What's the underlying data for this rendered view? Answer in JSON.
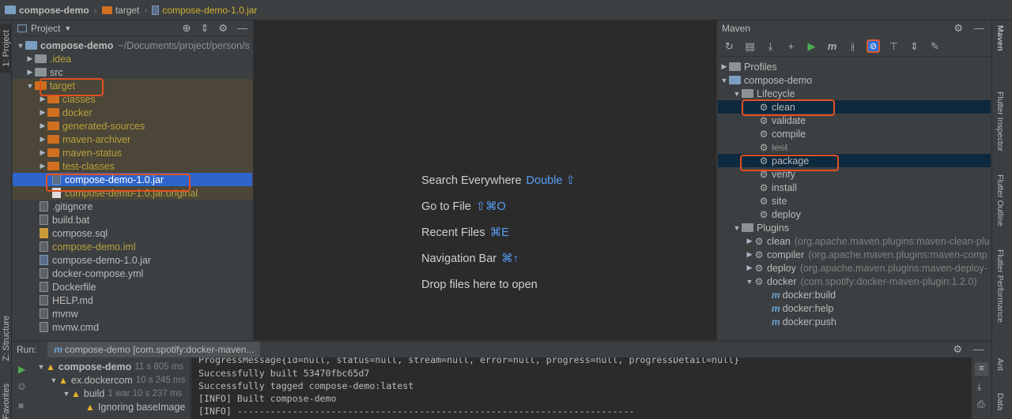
{
  "breadcrumb": {
    "project": "compose-demo",
    "folder": "target",
    "file": "compose-demo-1.0.jar"
  },
  "left_strip": {
    "project_tab": "1: Project",
    "structure_tab": "Z: Structure",
    "favorites_tab": "Favorites"
  },
  "project_panel": {
    "title": "Project",
    "root": {
      "name": "compose-demo",
      "path": "~/Documents/project/person/s"
    },
    "items": [
      {
        "label": ".idea"
      },
      {
        "label": "src"
      },
      {
        "label": "target"
      },
      {
        "label": "classes"
      },
      {
        "label": "docker"
      },
      {
        "label": "generated-sources"
      },
      {
        "label": "maven-archiver"
      },
      {
        "label": "maven-status"
      },
      {
        "label": "test-classes"
      },
      {
        "label": "compose-demo-1.0.jar"
      },
      {
        "label": "compose-demo-1.0.jar.original"
      },
      {
        "label": ".gitignore"
      },
      {
        "label": "build.bat"
      },
      {
        "label": "compose.sql"
      },
      {
        "label": "compose-demo.iml"
      },
      {
        "label": "compose-demo-1.0.jar"
      },
      {
        "label": "docker-compose.yml"
      },
      {
        "label": "Dockerfile"
      },
      {
        "label": "HELP.md"
      },
      {
        "label": "mvnw"
      },
      {
        "label": "mvnw.cmd"
      }
    ]
  },
  "editor_hints": [
    {
      "text": "Search Everywhere",
      "key": "Double ⇧"
    },
    {
      "text": "Go to File",
      "key": "⇧⌘O"
    },
    {
      "text": "Recent Files",
      "key": "⌘E"
    },
    {
      "text": "Navigation Bar",
      "key": "⌘↑"
    },
    {
      "text": "Drop files here to open",
      "key": ""
    }
  ],
  "maven": {
    "title": "Maven",
    "tree": {
      "profiles": "Profiles",
      "project": "compose-demo",
      "lifecycle": "Lifecycle",
      "phases": [
        "clean",
        "validate",
        "compile",
        "test",
        "package",
        "verify",
        "install",
        "site",
        "deploy"
      ],
      "plugins": "Plugins",
      "plugin_list": [
        {
          "name": "clean",
          "detail": "(org.apache.maven.plugins:maven-clean-plu"
        },
        {
          "name": "compiler",
          "detail": "(org.apache.maven.plugins:maven-comp"
        },
        {
          "name": "deploy",
          "detail": "(org.apache.maven.plugins:maven-deploy-"
        },
        {
          "name": "docker",
          "detail": "(com.spotify:docker-maven-plugin:1.2.0)"
        }
      ],
      "goals": [
        "docker:build",
        "docker:help",
        "docker:push"
      ]
    }
  },
  "right_strip": {
    "tabs": [
      "Maven",
      "Flutter Inspector",
      "Flutter Outline",
      "Flutter Performance",
      "Ant",
      "Data"
    ]
  },
  "run": {
    "label": "Run:",
    "tab": "compose-demo [com.spotify:docker-maven...",
    "tree": [
      {
        "label": "compose-demo",
        "time": "11 s 805 ms"
      },
      {
        "label": "ex.dockercom",
        "time": "10 s 245 ms"
      },
      {
        "label": "build",
        "time": "1 war 10 s 237 ms"
      },
      {
        "label": "Ignoring baseImage",
        "time": ""
      }
    ],
    "console": [
      "ProgressMessage{id=null, status=null, stream=null, error=null, progress=null, progressDetail=null}",
      "Successfully built 53470fbc65d7",
      "Successfully tagged compose-demo:latest",
      "[INFO] Built compose-demo",
      "[INFO] ------------------------------------------------------------------------"
    ]
  },
  "colors": {
    "accent_selection": "#2f65ca",
    "highlight_box": "#e2501f",
    "excluded_folder": "#d06f1f",
    "maven_selected": "#0d293e"
  }
}
